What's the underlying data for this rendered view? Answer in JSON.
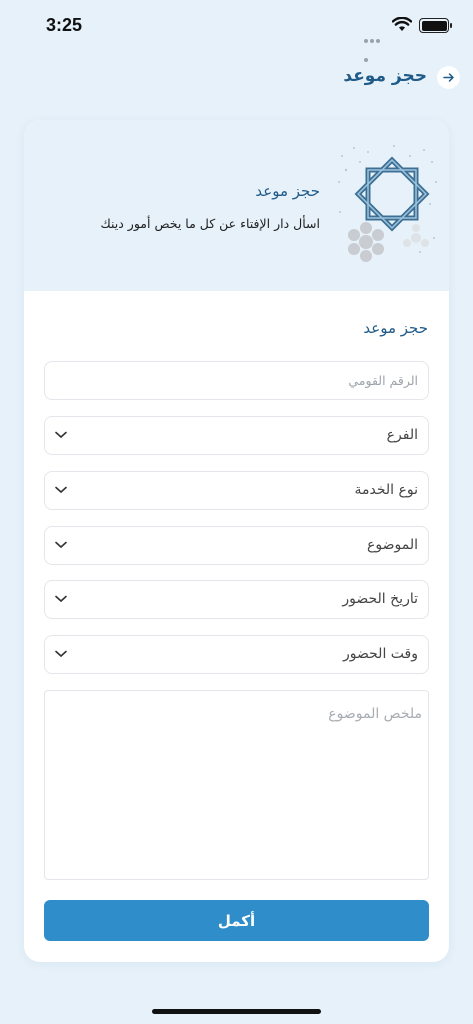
{
  "status_bar": {
    "time": "3:25"
  },
  "header": {
    "title": "حجز موعد"
  },
  "banner": {
    "title": "حجز موعد",
    "subtitle": "اسأل دار الإفتاء عن كل ما يخص أمور دينك"
  },
  "form": {
    "title": "حجز موعد",
    "national_id": {
      "placeholder": "الرقم القومي",
      "value": ""
    },
    "branch": {
      "label": "الفرع"
    },
    "service_type": {
      "label": "نوع الخدمة"
    },
    "subject": {
      "label": "الموضوع"
    },
    "attendance_date": {
      "label": "تاريخ الحضور"
    },
    "attendance_time": {
      "label": "وقت الحضور"
    },
    "summary": {
      "placeholder": "ملخص الموضوع",
      "value": ""
    },
    "submit_label": "أكمل"
  },
  "icons": {
    "back": "arrow-right-icon",
    "dropdown": "chevron-down-icon",
    "banner_art": "islamic-pattern-logo"
  },
  "colors": {
    "accent": "#2f8ec9",
    "title": "#1f5a88",
    "background": "#e6f1fa"
  }
}
